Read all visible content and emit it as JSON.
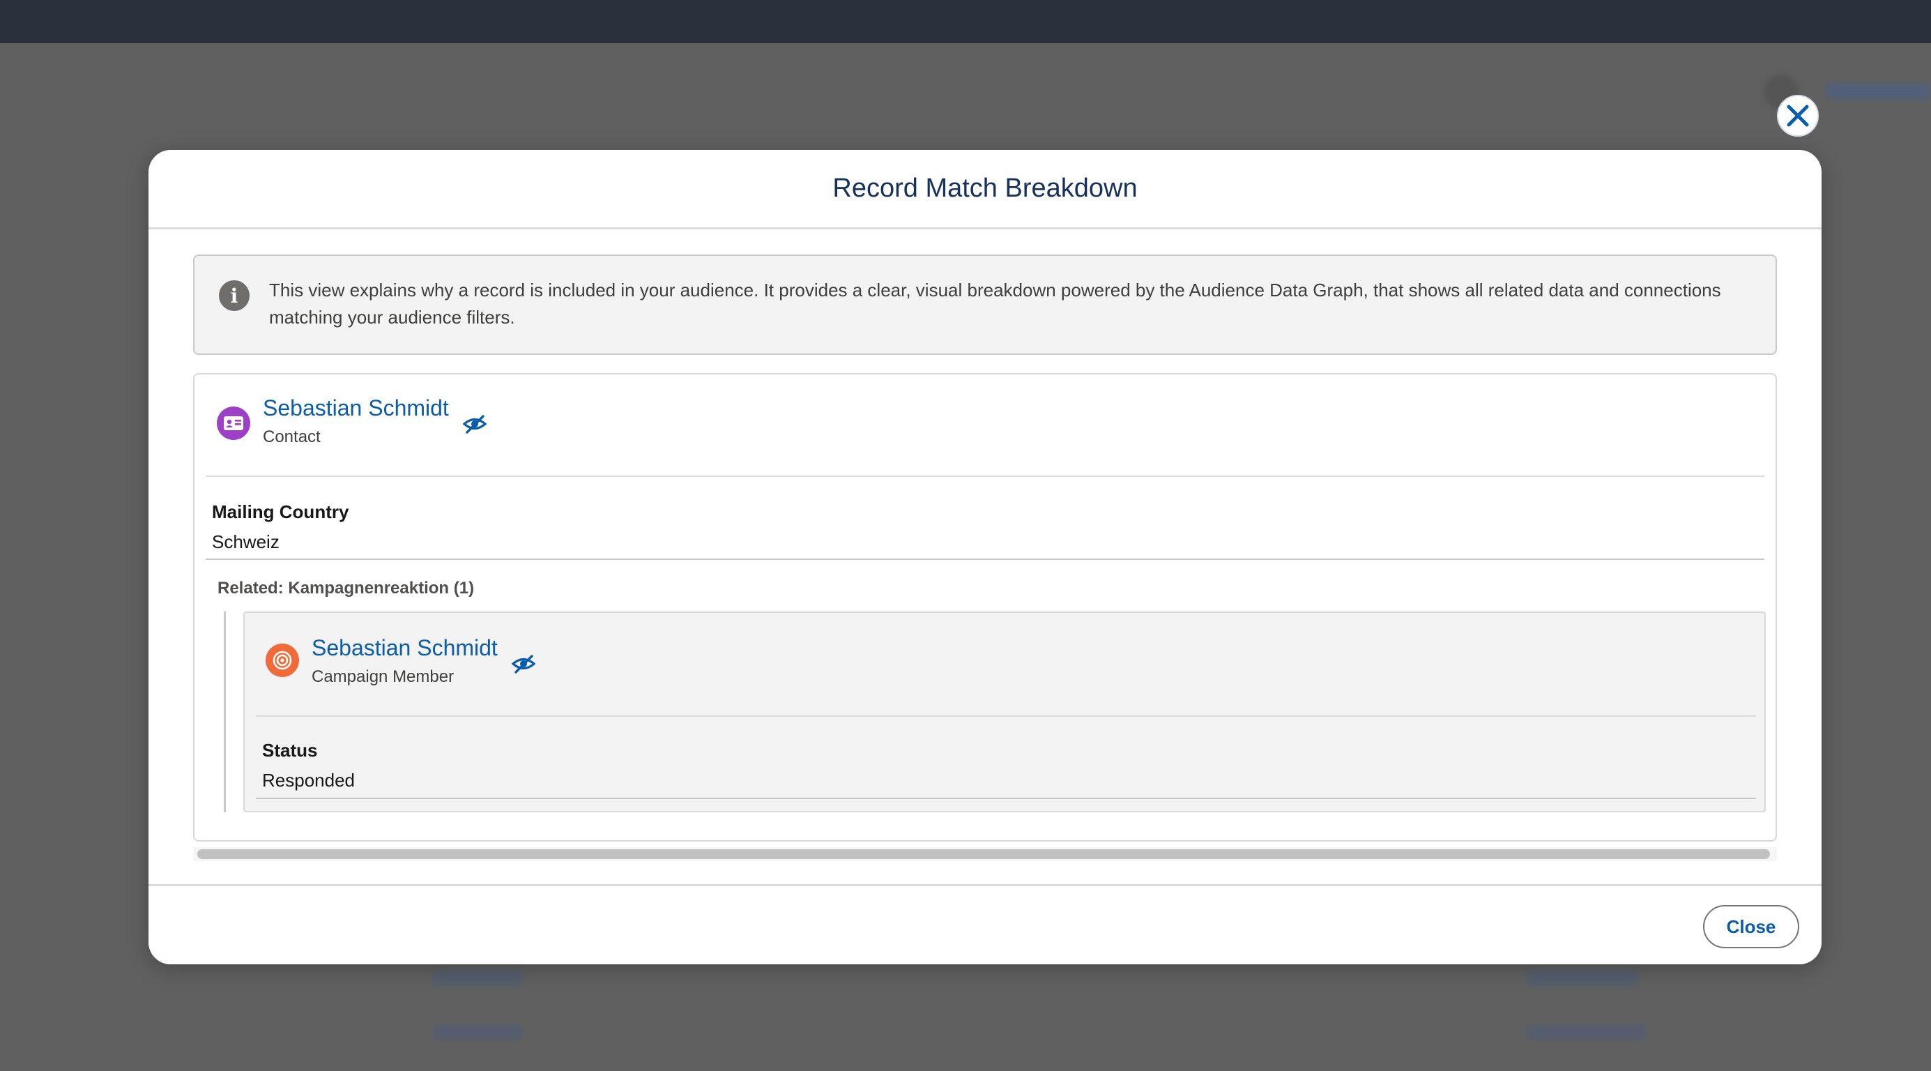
{
  "modal": {
    "title": "Record Match Breakdown",
    "info_text": "This view explains why a record is included in your audience. It provides a clear, visual breakdown powered by the Audience Data Graph, that shows all related data and connections matching your audience filters.",
    "close_label": "Close"
  },
  "record": {
    "name": "Sebastian Schmidt",
    "type": "Contact",
    "icon": "contact-card-icon",
    "icon_color": "#9e3fc7",
    "fields": [
      {
        "label": "Mailing Country",
        "value": "Schweiz"
      }
    ],
    "related": {
      "title": "Related: Kampagnenreaktion (1)",
      "record": {
        "name": "Sebastian Schmidt",
        "type": "Campaign Member",
        "icon": "campaign-target-icon",
        "icon_color": "#f06a3a",
        "fields": [
          {
            "label": "Status",
            "value": "Responded"
          }
        ]
      }
    }
  },
  "colors": {
    "link": "#0b5cab",
    "title": "#16325c"
  }
}
